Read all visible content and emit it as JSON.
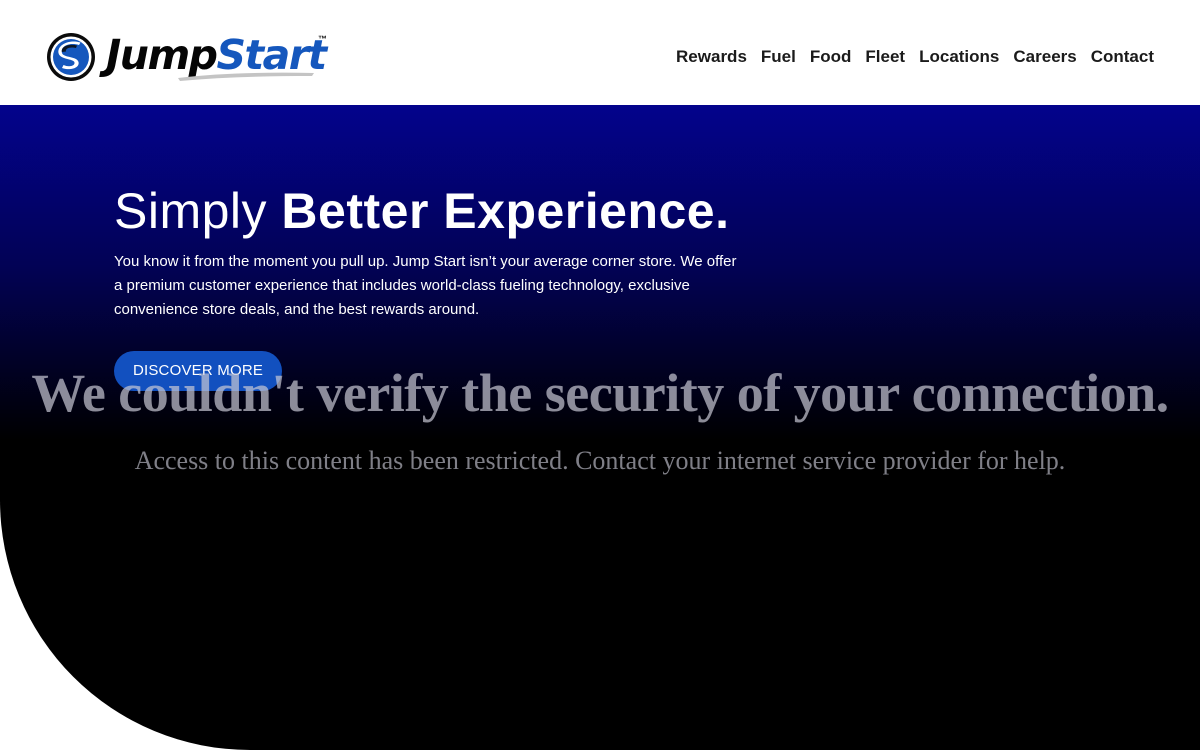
{
  "brand": {
    "name_part1": "Jump",
    "name_part2": "Start",
    "trademark": "™",
    "colors": {
      "dark": "#050505",
      "blue": "#1557bd",
      "swoosh": "#c4c4c4"
    }
  },
  "nav": {
    "items": [
      {
        "label": "Rewards"
      },
      {
        "label": "Fuel"
      },
      {
        "label": "Food"
      },
      {
        "label": "Fleet"
      },
      {
        "label": "Locations"
      },
      {
        "label": "Careers"
      },
      {
        "label": "Contact"
      }
    ]
  },
  "hero": {
    "title_light": "Simply ",
    "title_bold": "Better Experience.",
    "text": "You know it from the moment you pull up. Jump Start isn’t your average corner store. We offer a premium customer experience that includes world-class fueling technology, exclusive convenience store deals, and the best rewards around.",
    "button_label": "DISCOVER MORE",
    "colors": {
      "gradient_top": "#03038c",
      "gradient_bottom": "#000000",
      "button": "#1250bf"
    }
  },
  "block_message": {
    "title": "We couldn't verify the security of your connection.",
    "text": "Access to this content has been restricted. Contact your internet service provider for help."
  }
}
